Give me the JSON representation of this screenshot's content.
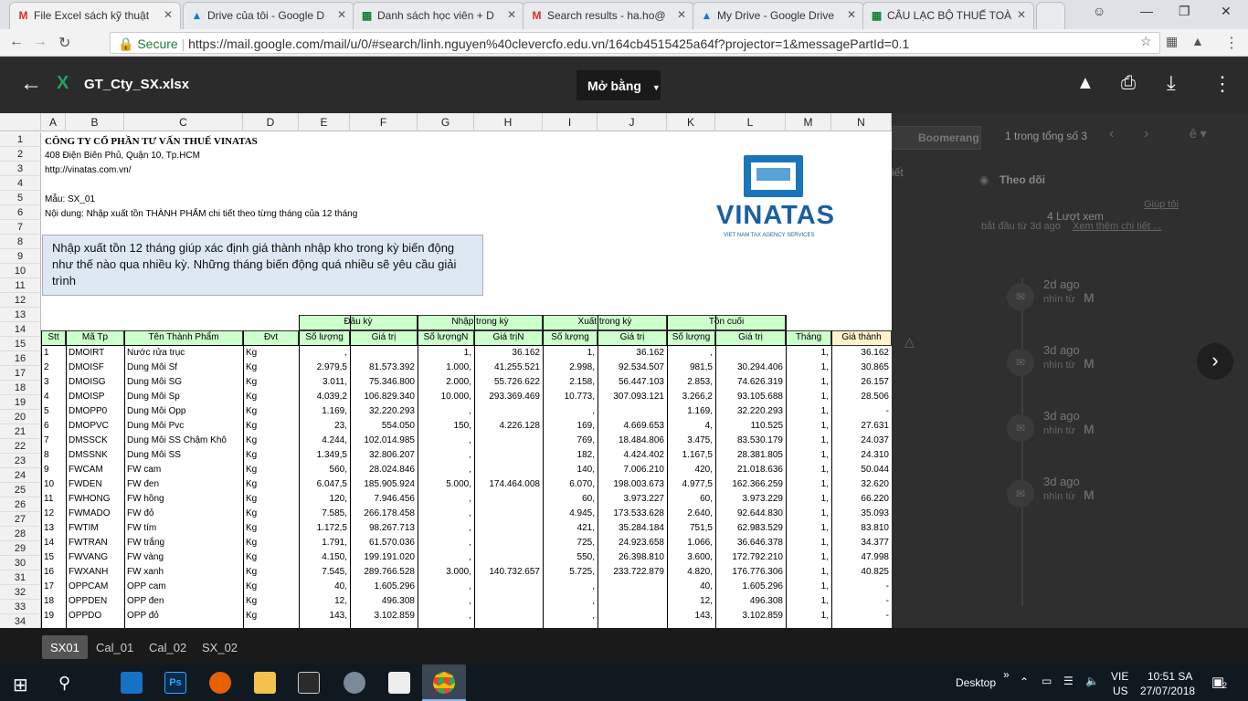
{
  "browser": {
    "tabs": [
      {
        "title": "File Excel sách kỹ thuật",
        "icon": "gmail-icon",
        "color": "#d93025"
      },
      {
        "title": "Drive của tôi - Google D",
        "icon": "drive-icon",
        "color": "#1a73e8"
      },
      {
        "title": "Danh sách học viên + D",
        "icon": "sheets-icon",
        "color": "#188038"
      },
      {
        "title": "Search results - ha.ho@",
        "icon": "gmail-icon",
        "color": "#d93025"
      },
      {
        "title": "My Drive - Google Drive",
        "icon": "drive-icon",
        "color": "#1a73e8"
      },
      {
        "title": "CÂU LẠC BỘ THUẾ TOÀ",
        "icon": "sheets-icon",
        "color": "#188038"
      }
    ],
    "secure_label": "Secure",
    "url": "https://mail.google.com/mail/u/0/#search/linh.nguyen%40clevercfo.edu.vn/164cb4515425a64f?projector=1&messagePartId=0.1"
  },
  "viewer": {
    "filename": "GT_Cty_SX.xlsx",
    "open_with": "Mở bằng"
  },
  "sheet": {
    "columns": [
      "A",
      "B",
      "C",
      "D",
      "E",
      "F",
      "G",
      "H",
      "I",
      "J",
      "K",
      "L",
      "M",
      "N"
    ],
    "row_numbers": [
      "1",
      "2",
      "3",
      "4",
      "5",
      "6",
      "7",
      "8",
      "9",
      "10",
      "11",
      "12",
      "13",
      "14",
      "15",
      "16",
      "17",
      "18",
      "19",
      "20",
      "21",
      "22",
      "23",
      "24",
      "25",
      "26",
      "27",
      "28",
      "29",
      "30",
      "31",
      "32",
      "33",
      "34"
    ],
    "company": "CÔNG TY CỔ PHẦN TƯ VẤN THUẾ VINATAS",
    "address": "408 Điện Biên Phủ, Quận 10, Tp.HCM",
    "website": "http://vinatas.com.vn/",
    "form": "Mẫu: SX_01",
    "content": "Nội dung: Nhập xuất tồn THÀNH PHẨM chi tiết theo từng tháng của 12 tháng",
    "note": "Nhập xuất tồn 12 tháng giúp xác định giá thành nhập kho trong kỳ biến động như thế nào qua nhiều kỳ. Những tháng biến động quá nhiều sẽ yêu cầu giải trình",
    "logo_text": "VINATAS",
    "logo_sub": "VIET NAM TAX AGENCY SERVICES",
    "group_headers": [
      "Đầu kỳ",
      "Nhập trong kỳ",
      "Xuất trong kỳ",
      "Tồn cuối"
    ],
    "headers": [
      "Stt",
      "Mã Tp",
      "Tên Thành Phẩm",
      "Đvt",
      "Số lượng",
      "Giá trị",
      "Số lượngN",
      "Giá trịN",
      "Số lượng",
      "Giá trị",
      "Số lượng",
      "Giá trị",
      "Tháng",
      "Giá thành"
    ],
    "rows": [
      [
        "1",
        "DMOIRT",
        "Nước rửa trục",
        "Kg",
        ",",
        "",
        "1,",
        "36.162",
        "1,",
        "36.162",
        ",",
        "",
        "1,",
        "36.162"
      ],
      [
        "2",
        "DMOISF",
        "Dung Môi Sf",
        "Kg",
        "2.979,5",
        "81.573.392",
        "1.000,",
        "41.255.521",
        "2.998,",
        "92.534.507",
        "981,5",
        "30.294.406",
        "1,",
        "30.865"
      ],
      [
        "3",
        "DMOISG",
        "Dung Môi SG",
        "Kg",
        "3.011,",
        "75.346.800",
        "2.000,",
        "55.726.622",
        "2.158,",
        "56.447.103",
        "2.853,",
        "74.626.319",
        "1,",
        "26.157"
      ],
      [
        "4",
        "DMOISP",
        "Dung Môi Sp",
        "Kg",
        "4.039,2",
        "106.829.340",
        "10.000,",
        "293.369.469",
        "10.773,",
        "307.093.121",
        "3.266,2",
        "93.105.688",
        "1,",
        "28.506"
      ],
      [
        "5",
        "DMOPP0",
        "Dung Môi Opp",
        "Kg",
        "1.169,",
        "32.220.293",
        ",",
        "",
        ",",
        "",
        "1.169,",
        "32.220.293",
        "1,",
        "-"
      ],
      [
        "6",
        "DMOPVC",
        "Dung Môi Pvc",
        "Kg",
        "23,",
        "554.050",
        "150,",
        "4.226.128",
        "169,",
        "4.669.653",
        "4,",
        "110.525",
        "1,",
        "27.631"
      ],
      [
        "7",
        "DMSSCK",
        "Dung Môi SS Chậm Khô",
        "Kg",
        "4.244,",
        "102.014.985",
        ",",
        "",
        "769,",
        "18.484.806",
        "3.475,",
        "83.530.179",
        "1,",
        "24.037"
      ],
      [
        "8",
        "DMSSNK",
        "Dung Môi SS",
        "Kg",
        "1.349,5",
        "32.806.207",
        ",",
        "",
        "182,",
        "4.424.402",
        "1.167,5",
        "28.381.805",
        "1,",
        "24.310"
      ],
      [
        "9",
        "FWCAM",
        "FW cam",
        "Kg",
        "560,",
        "28.024.846",
        ",",
        "",
        "140,",
        "7.006.210",
        "420,",
        "21.018.636",
        "1,",
        "50.044"
      ],
      [
        "10",
        "FWDEN",
        "FW đen",
        "Kg",
        "6.047,5",
        "185.905.924",
        "5.000,",
        "174.464.008",
        "6.070,",
        "198.003.673",
        "4.977,5",
        "162.366.259",
        "1,",
        "32.620"
      ],
      [
        "11",
        "FWHONG",
        "FW hồng",
        "Kg",
        "120,",
        "7.946.456",
        ",",
        "",
        "60,",
        "3.973.227",
        "60,",
        "3.973.229",
        "1,",
        "66.220"
      ],
      [
        "12",
        "FWMADO",
        "FW đỏ",
        "Kg",
        "7.585,",
        "266.178.458",
        ",",
        "",
        "4.945,",
        "173.533.628",
        "2.640,",
        "92.644.830",
        "1,",
        "35.093"
      ],
      [
        "13",
        "FWTIM",
        "FW tím",
        "Kg",
        "1.172,5",
        "98.267.713",
        ",",
        "",
        "421,",
        "35.284.184",
        "751,5",
        "62.983.529",
        "1,",
        "83.810"
      ],
      [
        "14",
        "FWTRAN",
        "FW trắng",
        "Kg",
        "1.791,",
        "61.570.036",
        ",",
        "",
        "725,",
        "24.923.658",
        "1.066,",
        "36.646.378",
        "1,",
        "34.377"
      ],
      [
        "15",
        "FWVANG",
        "FW vàng",
        "Kg",
        "4.150,",
        "199.191.020",
        ",",
        "",
        "550,",
        "26.398.810",
        "3.600,",
        "172.792.210",
        "1,",
        "47.998"
      ],
      [
        "16",
        "FWXANH",
        "FW xanh",
        "Kg",
        "7.545,",
        "289.766.528",
        "3.000,",
        "140.732.657",
        "5.725,",
        "233.722.879",
        "4.820,",
        "176.776.306",
        "1,",
        "40.825"
      ],
      [
        "17",
        "OPPCAM",
        "OPP cam",
        "Kg",
        "40,",
        "1.605.296",
        ",",
        "",
        ",",
        "",
        "40,",
        "1.605.296",
        "1,",
        "-"
      ],
      [
        "18",
        "OPPDEN",
        "OPP đen",
        "Kg",
        "12,",
        "496.308",
        ",",
        "",
        ",",
        "",
        "12,",
        "496.308",
        "1,",
        "-"
      ],
      [
        "19",
        "OPPDO",
        "OPP đỏ",
        "Kg",
        "143,",
        "3.102.859",
        ",",
        "",
        ",",
        "",
        "143,",
        "3.102.859",
        "1,",
        "-"
      ]
    ]
  },
  "side_panel": {
    "boomerang": "Boomerang",
    "count": "1 trong tổng số 3",
    "follow": "Theo dõi",
    "help": "Giúp tôi",
    "views": "4 Lượt xem",
    "since": "bắt đầu từ 3d ago",
    "see_more": "Xem thêm chi tiết ...",
    "events": [
      {
        "time": "2d ago",
        "from": "nhìn từ"
      },
      {
        "time": "3d ago",
        "from": "nhìn từ"
      },
      {
        "time": "3d ago",
        "from": "nhìn từ"
      },
      {
        "time": "3d ago",
        "from": "nhìn từ"
      }
    ],
    "left_text": "iết"
  },
  "sheet_tabs": [
    "SX01",
    "Cal_01",
    "Cal_02",
    "SX_02"
  ],
  "taskbar": {
    "desktop": "Desktop",
    "lang1": "VIE",
    "lang2": "US",
    "time": "10:51 SA",
    "date": "27/07/2018",
    "notif": "2"
  }
}
